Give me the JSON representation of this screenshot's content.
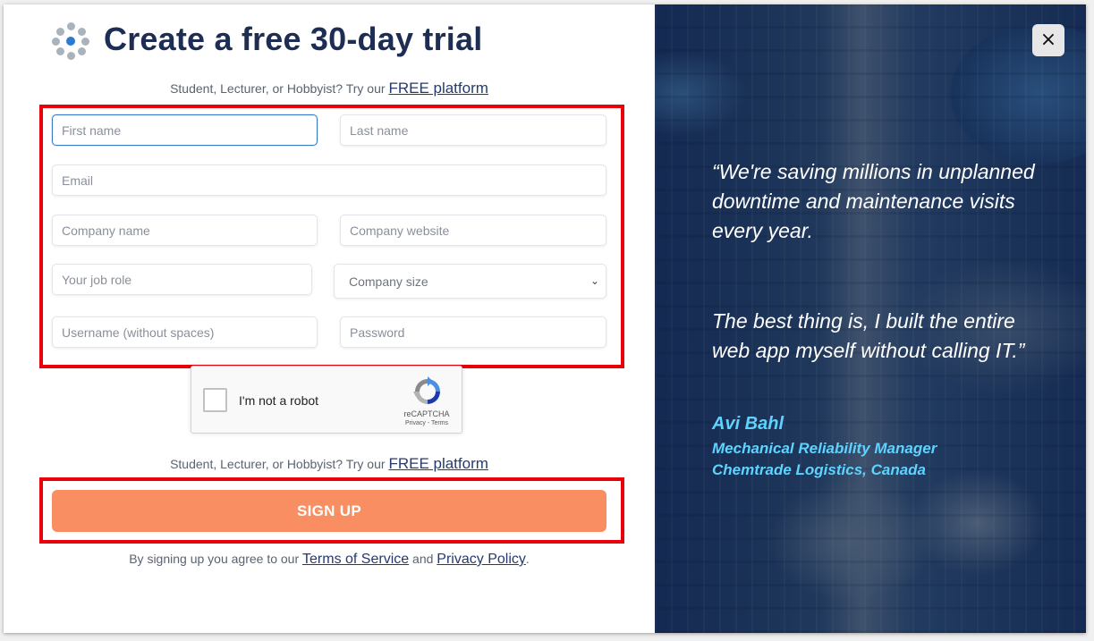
{
  "header": {
    "title": "Create a free 30-day trial",
    "promo_text": "Student, Lecturer, or Hobbyist? Try our",
    "promo_link": "FREE platform"
  },
  "form": {
    "first_name": {
      "placeholder": "First name"
    },
    "last_name": {
      "placeholder": "Last name"
    },
    "email": {
      "placeholder": "Email"
    },
    "company_name": {
      "placeholder": "Company name"
    },
    "company_website": {
      "placeholder": "Company website"
    },
    "job_role": {
      "placeholder": "Your job role"
    },
    "company_size": {
      "selected": "Company size"
    },
    "username": {
      "placeholder": "Username (without spaces)"
    },
    "password": {
      "placeholder": "Password"
    }
  },
  "captcha": {
    "label": "I'm not a robot",
    "brand": "reCAPTCHA",
    "links": "Privacy - Terms"
  },
  "footer": {
    "promo_text": "Student, Lecturer, or Hobbyist? Try our",
    "promo_link": "FREE platform",
    "signup_label": "SIGN UP",
    "terms_prefix": "By signing up you agree to our",
    "terms_link": "Terms of Service",
    "terms_and": "and",
    "privacy_link": "Privacy Policy",
    "terms_suffix": "."
  },
  "testimonial": {
    "quote_1": "“We're saving millions in unplanned downtime and maintenance visits every year.",
    "quote_2": "The best thing is, I built the entire web app myself without calling IT.”",
    "author": "Avi Bahl",
    "role": "Mechanical Reliability Manager",
    "company": "Chemtrade Logistics, Canada"
  },
  "close_label": "×",
  "colors": {
    "title": "#1d2d53",
    "signup": "#f98e62",
    "highlight": "#e8000b",
    "author_accent": "#5fd3ff"
  }
}
